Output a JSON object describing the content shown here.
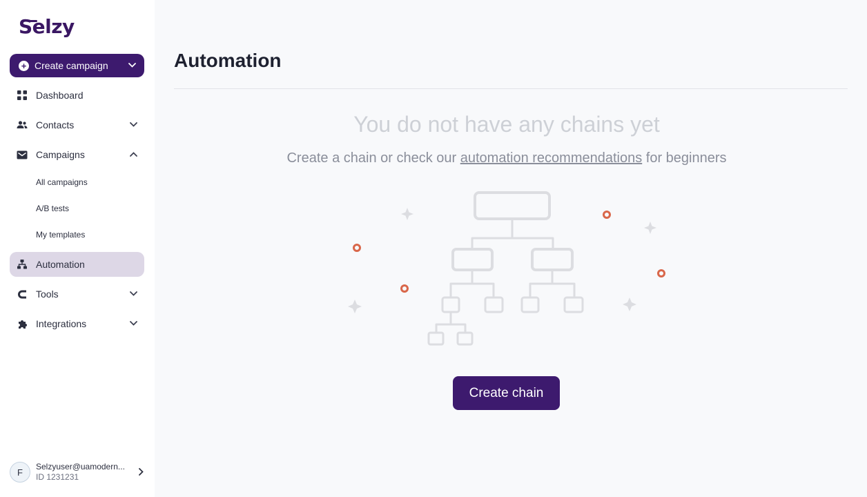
{
  "app": {
    "logo_text": "Selzy"
  },
  "sidebar": {
    "create_campaign_label": "Create campaign",
    "items": [
      {
        "label": "Dashboard",
        "icon": "grid-icon",
        "expandable": false
      },
      {
        "label": "Contacts",
        "icon": "people-icon",
        "expandable": true
      },
      {
        "label": "Campaigns",
        "icon": "mail-icon",
        "expandable": true,
        "expanded": true,
        "children": [
          "All campaigns",
          "A/B tests",
          "My templates"
        ]
      },
      {
        "label": "Automation",
        "icon": "sitemap-icon",
        "active": true
      },
      {
        "label": "Tools",
        "icon": "magnet-icon",
        "expandable": true
      },
      {
        "label": "Integrations",
        "icon": "puzzle-icon",
        "expandable": true
      }
    ],
    "user": {
      "initial": "F",
      "email": "Selzyuser@uamodern...",
      "id": "ID 1231231"
    }
  },
  "main": {
    "title": "Automation",
    "empty_title": "You do not have any chains yet",
    "empty_sub_before": "Create a chain or check our ",
    "empty_sub_link": "automation recommendations",
    "empty_sub_after": " for beginners",
    "create_chain_label": "Create chain"
  },
  "colors": {
    "brand": "#3d1a6e",
    "active_nav_bg": "#ddd7e6",
    "accent_dot": "#d9674a"
  }
}
